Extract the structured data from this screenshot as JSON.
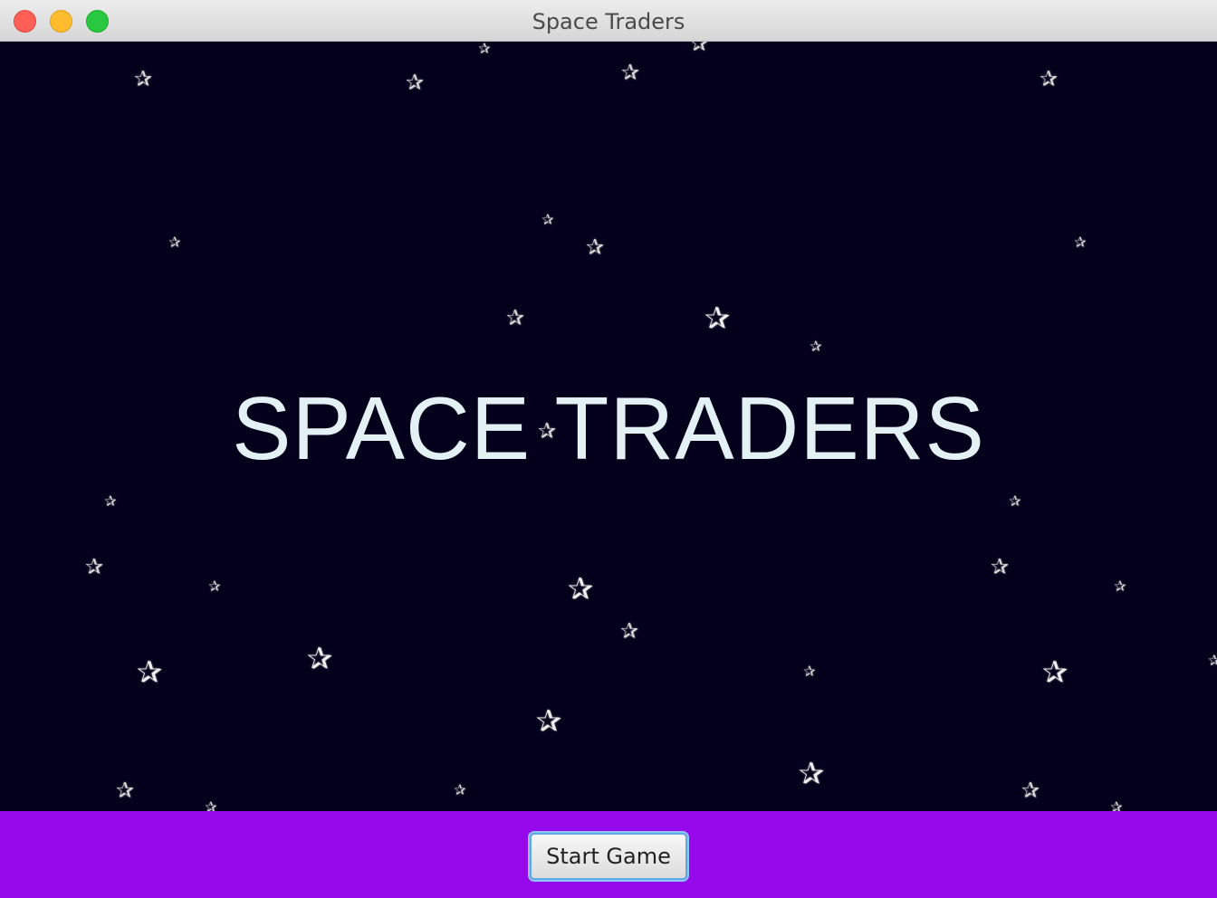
{
  "window": {
    "title": "Space Traders"
  },
  "main": {
    "game_title": "SPACE TRADERS",
    "background_color": "#04001c",
    "star_icon": "star-icon",
    "star_glyph": "✰"
  },
  "footer": {
    "background_color": "#9509ea",
    "start_button_label": "Start Game"
  }
}
